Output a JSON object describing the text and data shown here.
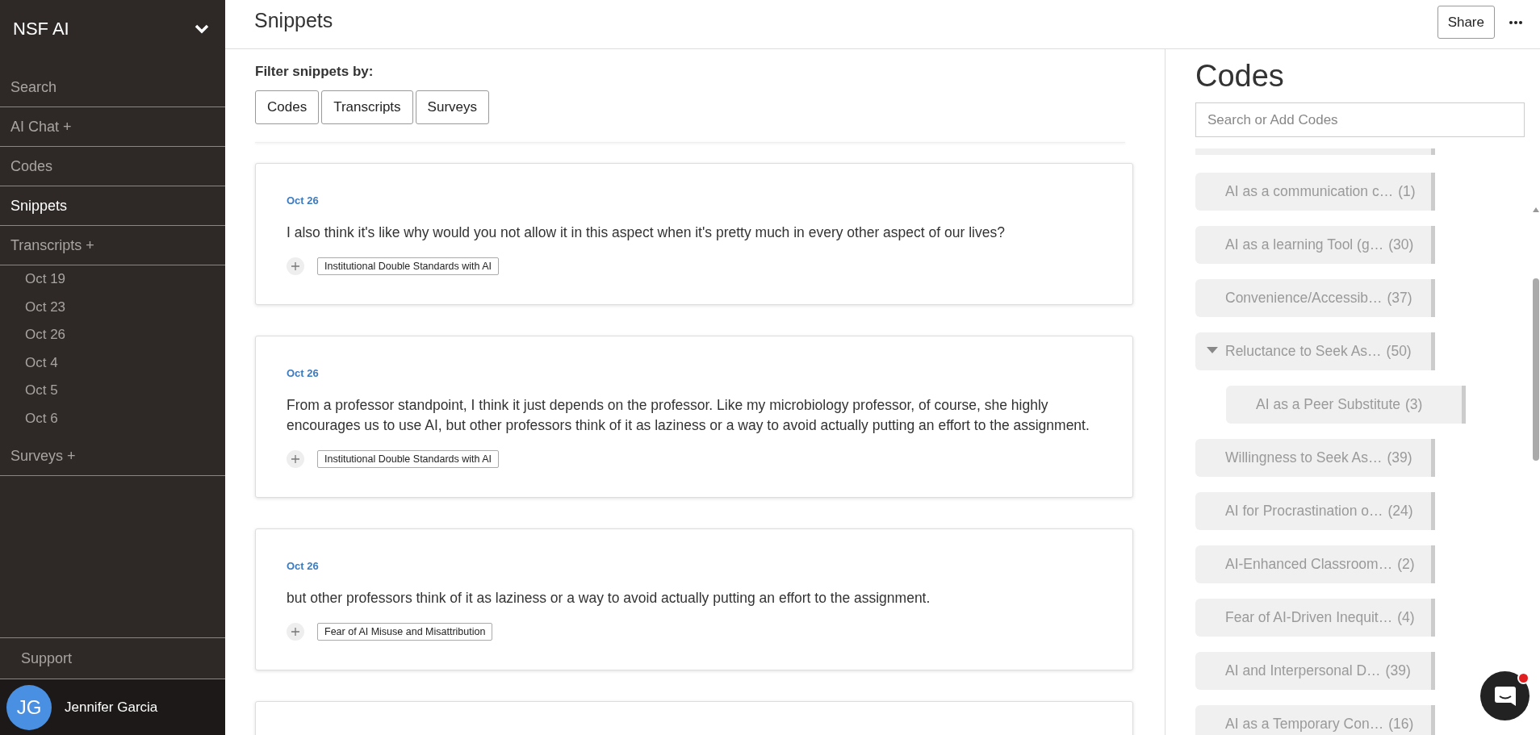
{
  "sidebar": {
    "workspace": "NSF AI",
    "nav": [
      {
        "label": "Search",
        "selected": false
      },
      {
        "label": "AI Chat +",
        "selected": false
      },
      {
        "label": "Codes",
        "selected": false
      },
      {
        "label": "Snippets",
        "selected": true
      },
      {
        "label": "Transcripts +",
        "selected": false,
        "children": [
          {
            "label": "Oct 19"
          },
          {
            "label": "Oct 23"
          },
          {
            "label": "Oct 26"
          },
          {
            "label": "Oct 4"
          },
          {
            "label": "Oct 5"
          },
          {
            "label": "Oct 6"
          }
        ]
      },
      {
        "label": "Surveys +",
        "selected": false
      }
    ],
    "support": "Support",
    "user": {
      "initials": "JG",
      "name": "Jennifer Garcia"
    }
  },
  "header": {
    "title": "Snippets",
    "share": "Share"
  },
  "filter": {
    "label": "Filter snippets by:",
    "buttons": [
      "Codes",
      "Transcripts",
      "Surveys"
    ]
  },
  "snippets": [
    {
      "date": "Oct 26",
      "text": "I also think it's like why would you not allow it in this aspect when it's pretty much in every other aspect of our lives?",
      "tags": [
        "Institutional Double Standards with AI"
      ]
    },
    {
      "date": "Oct 26",
      "text": "From a professor standpoint, I think it just depends on the professor. Like my microbiology professor, of course, she highly encourages us to use AI, but other professors think of it as laziness or a way to avoid actually putting an effort to the assignment.",
      "tags": [
        "Institutional Double Standards with AI"
      ]
    },
    {
      "date": "Oct 26",
      "text": "but other professors think of it as laziness or a way to avoid actually putting an effort to the assignment.",
      "tags": [
        "Fear of AI Misuse and Misattribution"
      ]
    }
  ],
  "codes_panel": {
    "title": "Codes",
    "search": {
      "placeholder": "Search or Add Codes"
    },
    "codes": [
      {
        "label": "AI as a communication c…",
        "count": "(1)"
      },
      {
        "label": "AI as a learning Tool (g…",
        "count": "(30)"
      },
      {
        "label": "Convenience/Accessib…",
        "count": "(37)"
      },
      {
        "label": "Reluctance to Seek As…",
        "count": "(50)",
        "expanded": true,
        "children": [
          {
            "label": "AI as a Peer Substitute",
            "count": "(3)"
          }
        ]
      },
      {
        "label": "Willingness to Seek As…",
        "count": "(39)"
      },
      {
        "label": "AI for Procrastination o…",
        "count": "(24)"
      },
      {
        "label": "AI-Enhanced Classroom…",
        "count": "(2)"
      },
      {
        "label": "Fear of AI-Driven Inequit…",
        "count": "(4)"
      },
      {
        "label": "AI and Interpersonal D…",
        "count": "(39)"
      },
      {
        "label": "AI as a Temporary Con…",
        "count": "(16)"
      }
    ]
  }
}
